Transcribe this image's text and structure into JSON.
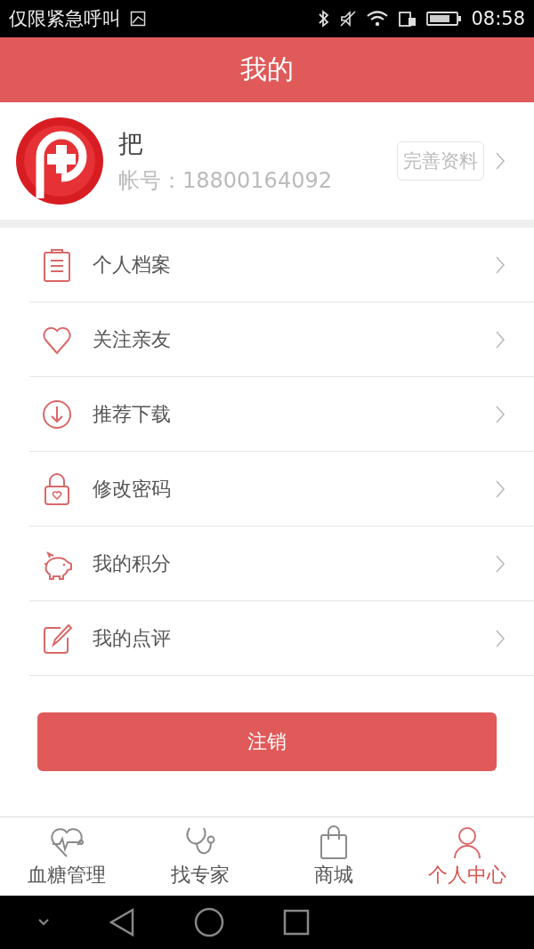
{
  "status_bar": {
    "carrier": "仅限紧急呼叫",
    "time": "08:58"
  },
  "header": {
    "title": "我的"
  },
  "profile": {
    "name": "把",
    "account": "帐号：18800164092",
    "edit_button": "完善资料"
  },
  "menu": [
    {
      "label": "个人档案"
    },
    {
      "label": "关注亲友"
    },
    {
      "label": "推荐下载"
    },
    {
      "label": "修改密码"
    },
    {
      "label": "我的积分"
    },
    {
      "label": "我的点评"
    }
  ],
  "logout_button": "注销",
  "tabs": [
    {
      "label": "血糖管理",
      "selected": false
    },
    {
      "label": "找专家",
      "selected": false
    },
    {
      "label": "商城",
      "selected": false
    },
    {
      "label": "个人中心",
      "selected": true
    }
  ]
}
